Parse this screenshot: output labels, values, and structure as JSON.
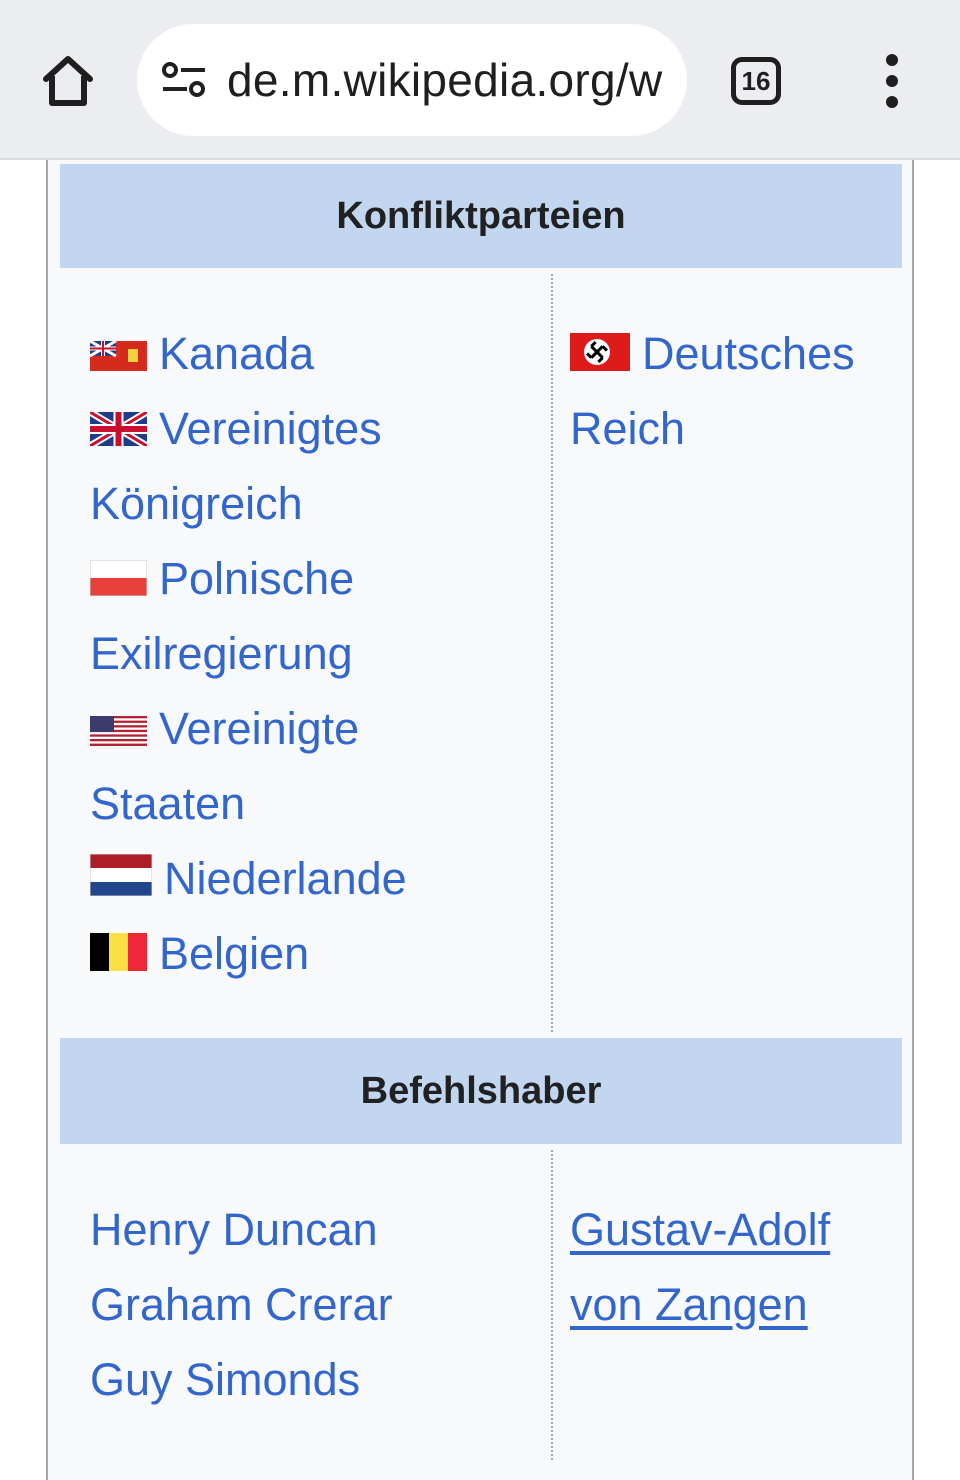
{
  "browser": {
    "url": "de.m.wikipedia.org/w",
    "tab_count": "16"
  },
  "infobox": {
    "section1_title": "Konfliktparteien",
    "section2_title": "Befehlshaber",
    "allies_line1": [
      "Kanada",
      "Vereinigtes"
    ],
    "allies": {
      "kanada": "Kanada",
      "uk_1": "Vereinigtes",
      "uk_2": "Königreich",
      "pl_1": "Polnische",
      "pl_2": "Exilregierung",
      "us_1": "Vereinigte",
      "us_2": "Staaten",
      "nl": "Niederlande",
      "be": "Belgien"
    },
    "axis": {
      "de_1": "Deutsches",
      "de_2": "Reich"
    },
    "commanders_left": {
      "line1": "Henry Duncan",
      "line2": "Graham Crerar",
      "line3": "Guy Simonds"
    },
    "commanders_right": {
      "line1": "Gustav-Adolf",
      "line2": "von Zangen"
    }
  },
  "colors": {
    "link": "#3366cc",
    "header_bg": "#c3d6ef",
    "box_bg": "#f8f9fa",
    "toolbar_bg": "#ecedf1"
  },
  "icons": [
    "home-icon",
    "site-settings-icon",
    "tab-switcher-icon",
    "more-menu-icon",
    "flag-canada-icon",
    "flag-uk-icon",
    "flag-poland-icon",
    "flag-usa-icon",
    "flag-netherlands-icon",
    "flag-belgium-icon",
    "flag-german-reich-icon"
  ]
}
